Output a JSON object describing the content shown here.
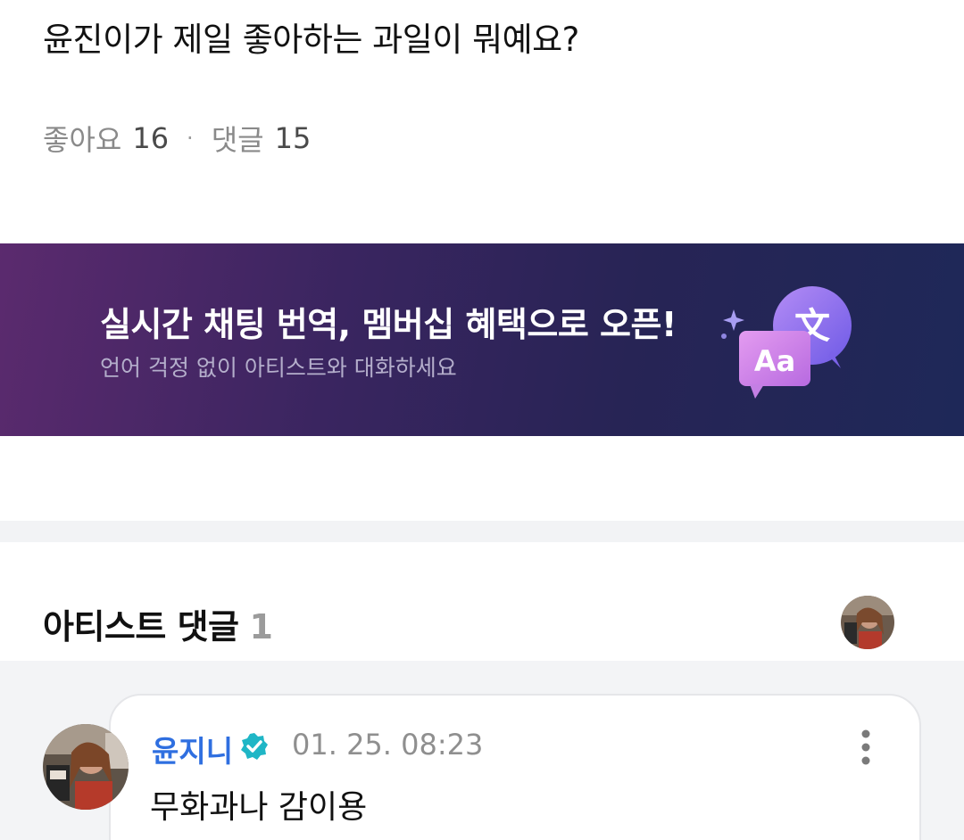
{
  "post": {
    "title": "윤진이가 제일 좋아하는 과일이 뭐예요?",
    "likes_label": "좋아요",
    "likes_count": "16",
    "separator": "·",
    "comments_label": "댓글",
    "comments_count": "15"
  },
  "banner": {
    "title": "실시간 채팅 번역, 멤버십 혜택으로 오픈!",
    "subtitle": "언어 걱정 없이 아티스트와 대화하세요",
    "icon_front_text": "Aa",
    "icon_back_text": "文",
    "icons": [
      "sparkle-icon",
      "translate-bubble-icon"
    ]
  },
  "artist_comments": {
    "heading": "아티스트 댓글",
    "count": "1",
    "avatar_icon": "artist-avatar"
  },
  "comment": {
    "author": "윤지니",
    "verified_icon": "verified-badge-icon",
    "timestamp": "01. 25. 08:23",
    "text": "무화과나 감이용",
    "more_icon": "more-vertical-icon"
  },
  "colors": {
    "author_blue": "#2f6fe0",
    "verified_teal": "#1fb6c6",
    "banner_start": "#5b2a6e",
    "banner_end": "#1e2858",
    "bubble_purple": "#8b6cf0",
    "bubble_pink": "#d07be3"
  }
}
